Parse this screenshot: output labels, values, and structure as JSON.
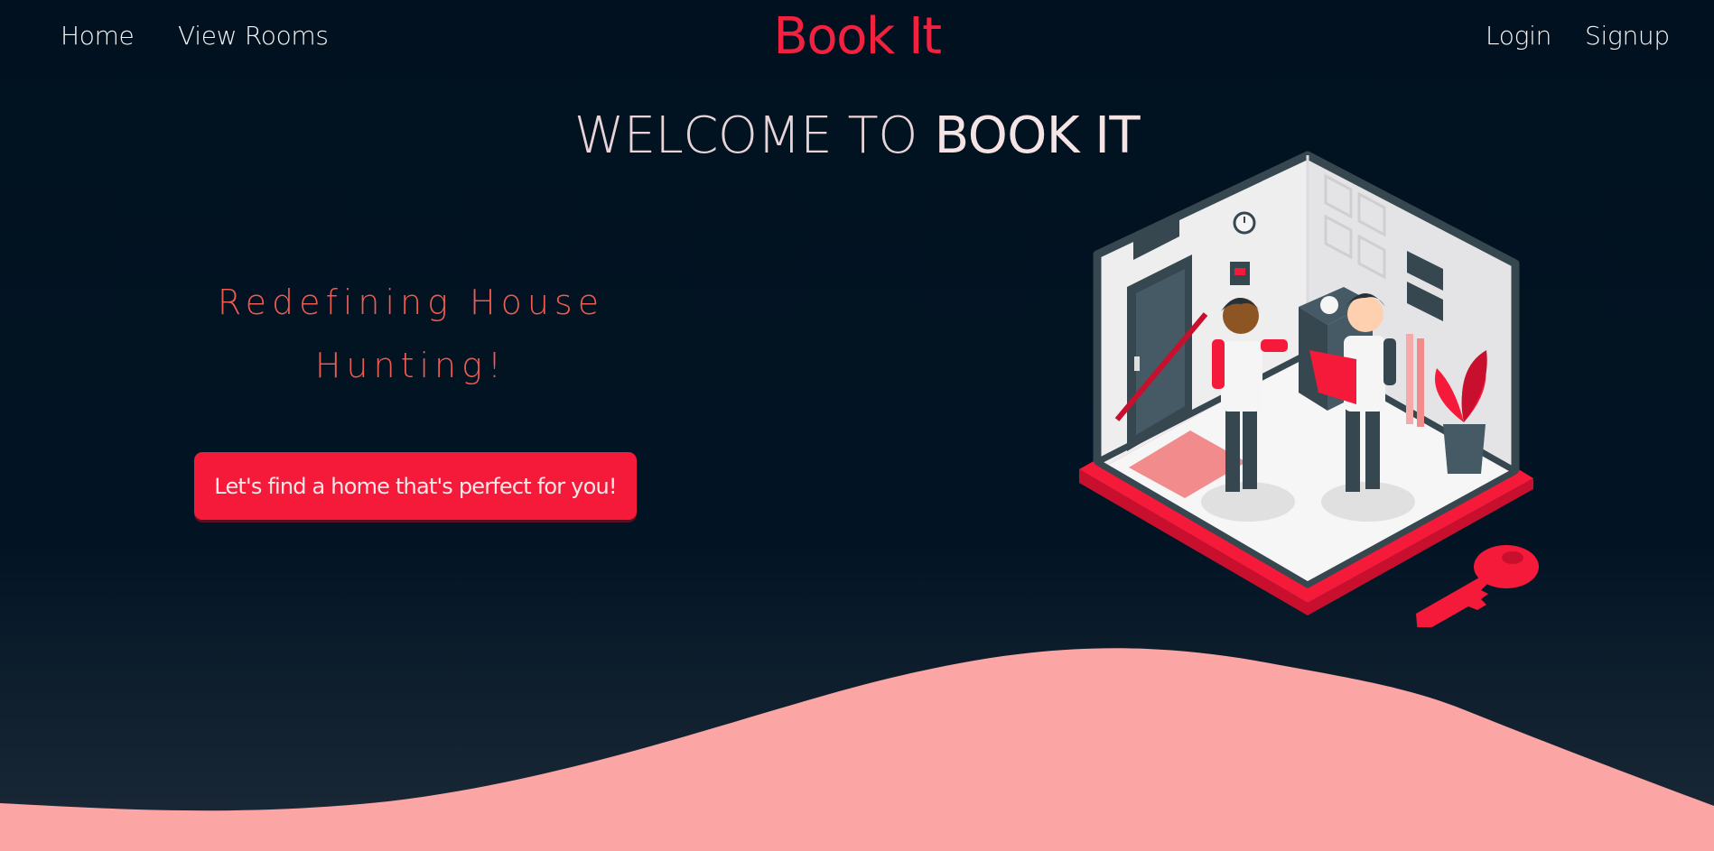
{
  "nav": {
    "home": "Home",
    "view_rooms": "View Rooms",
    "brand": "Book It",
    "login": "Login",
    "signup": "Signup"
  },
  "hero": {
    "welcome_prefix": "WELCOME TO",
    "welcome_brand": "BOOK IT",
    "tagline_line1": "Redefining House",
    "tagline_line2": "Hunting!",
    "cta_label": "Let's find a home that's perfect for you!"
  },
  "colors": {
    "background": "#021424",
    "brand_red": "#f2213f",
    "tagline_coral": "#f15a4f",
    "button_red": "#f5193a",
    "wave_pink": "#fba5a5"
  },
  "illustration": {
    "subject": "isometric room with two people, door, plant and key"
  }
}
